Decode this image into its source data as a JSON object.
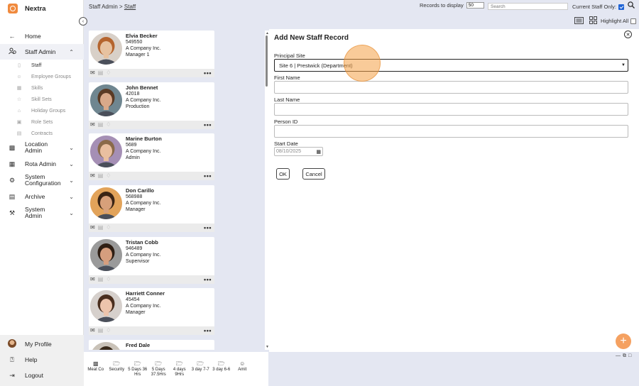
{
  "app": {
    "name": "Nextra"
  },
  "sidebar": {
    "items": [
      {
        "label": "Home",
        "icon": "arrow-left-icon"
      },
      {
        "label": "Staff Admin",
        "icon": "user-group-icon",
        "expanded": true
      },
      {
        "label": "Location Admin",
        "icon": "building-icon"
      },
      {
        "label": "Rota Admin",
        "icon": "calendar-grid-icon"
      },
      {
        "label": "System Configuration",
        "icon": "gear-icon"
      },
      {
        "label": "Archive",
        "icon": "archive-box-icon"
      },
      {
        "label": "System Admin",
        "icon": "wrench-icon"
      }
    ],
    "subitems": [
      {
        "label": "Staff",
        "active": true
      },
      {
        "label": "Employee Groups"
      },
      {
        "label": "Skills"
      },
      {
        "label": "Skill Sets"
      },
      {
        "label": "Holiday Groups"
      },
      {
        "label": "Role Sets"
      },
      {
        "label": "Contracts"
      }
    ],
    "bottom": [
      {
        "label": "My Profile"
      },
      {
        "label": "Help"
      },
      {
        "label": "Logout"
      }
    ]
  },
  "header": {
    "breadcrumb_root": "Staff Admin",
    "breadcrumb_sep": ">",
    "breadcrumb_current": "Staff",
    "records_label": "Records to display",
    "records_value": "50",
    "search_placeholder": "Search",
    "current_staff_label": "Current Staff Only:",
    "current_staff_checked": true,
    "highlight_label": "Highlight All",
    "highlight_checked": false
  },
  "staff": [
    {
      "name": "Elvia Becker",
      "id": "549550",
      "company": "A Company Inc.",
      "role": "Manager 1",
      "skin": "#e7c2a0",
      "hair": "#b5652e",
      "bg": "#d8d0c8",
      "notify_active": false
    },
    {
      "name": "John Bennet",
      "id": "42018",
      "company": "A Company Inc.",
      "role": "Production",
      "skin": "#d9a98a",
      "hair": "#5a3a24",
      "bg": "#6f8690",
      "notify_active": false
    },
    {
      "name": "Marine Burton",
      "id": "5689",
      "company": "A Company Inc.",
      "role": "Admin",
      "skin": "#e9bfa0",
      "hair": "#8a6a4a",
      "bg": "#a58fb5",
      "notify_active": false
    },
    {
      "name": "Don Carillo",
      "id": "568988",
      "company": "A Company Inc.",
      "role": "Manager",
      "skin": "#d7a07a",
      "hair": "#3a2414",
      "bg": "#e2a35a",
      "notify_active": false
    },
    {
      "name": "Tristan Cobb",
      "id": "946489",
      "company": "A Company Inc.",
      "role": "Supervisor",
      "skin": "#d59e7e",
      "hair": "#2e1e14",
      "bg": "#9a9a9a",
      "notify_active": false
    },
    {
      "name": "Harriett Conner",
      "id": "45454",
      "company": "A Company Inc.",
      "role": "Manager",
      "skin": "#ecc4ac",
      "hair": "#4a2e1e",
      "bg": "#d6d0cc",
      "notify_active": false
    },
    {
      "name": "Fred Dale",
      "id": "",
      "company": "",
      "role": "",
      "skin": "#d59e7e",
      "hair": "#3a2a1a",
      "bg": "#c9c2b8",
      "notify_active": false
    }
  ],
  "toolbar": [
    {
      "label": "Meat Co",
      "icon": "building-icon"
    },
    {
      "label": "Security",
      "icon": "folder-icon"
    },
    {
      "label": "5 Days 36 Hrs",
      "icon": "folder-icon"
    },
    {
      "label": "5 Days 37.5Hrs",
      "icon": "folder-icon"
    },
    {
      "label": "4 days 9Hrs",
      "icon": "folder-icon"
    },
    {
      "label": "3 day 7-7",
      "icon": "folder-icon"
    },
    {
      "label": "3 day 6-6",
      "icon": "folder-icon"
    },
    {
      "label": "Amit",
      "icon": "person-icon"
    }
  ],
  "form": {
    "title": "Add New Staff Record",
    "principal_site_label": "Principal Site",
    "principal_site_value": "Site 6 | Prestwick (Department)",
    "first_name_label": "First Name",
    "last_name_label": "Last Name",
    "person_id_label": "Person ID",
    "start_date_label": "Start Date",
    "start_date_value": "08/10/2025",
    "ok_label": "OK",
    "cancel_label": "Cancel"
  },
  "colors": {
    "accent": "#f08a3e",
    "background": "#e4e7f2",
    "checkbox": "#1e63d6"
  }
}
